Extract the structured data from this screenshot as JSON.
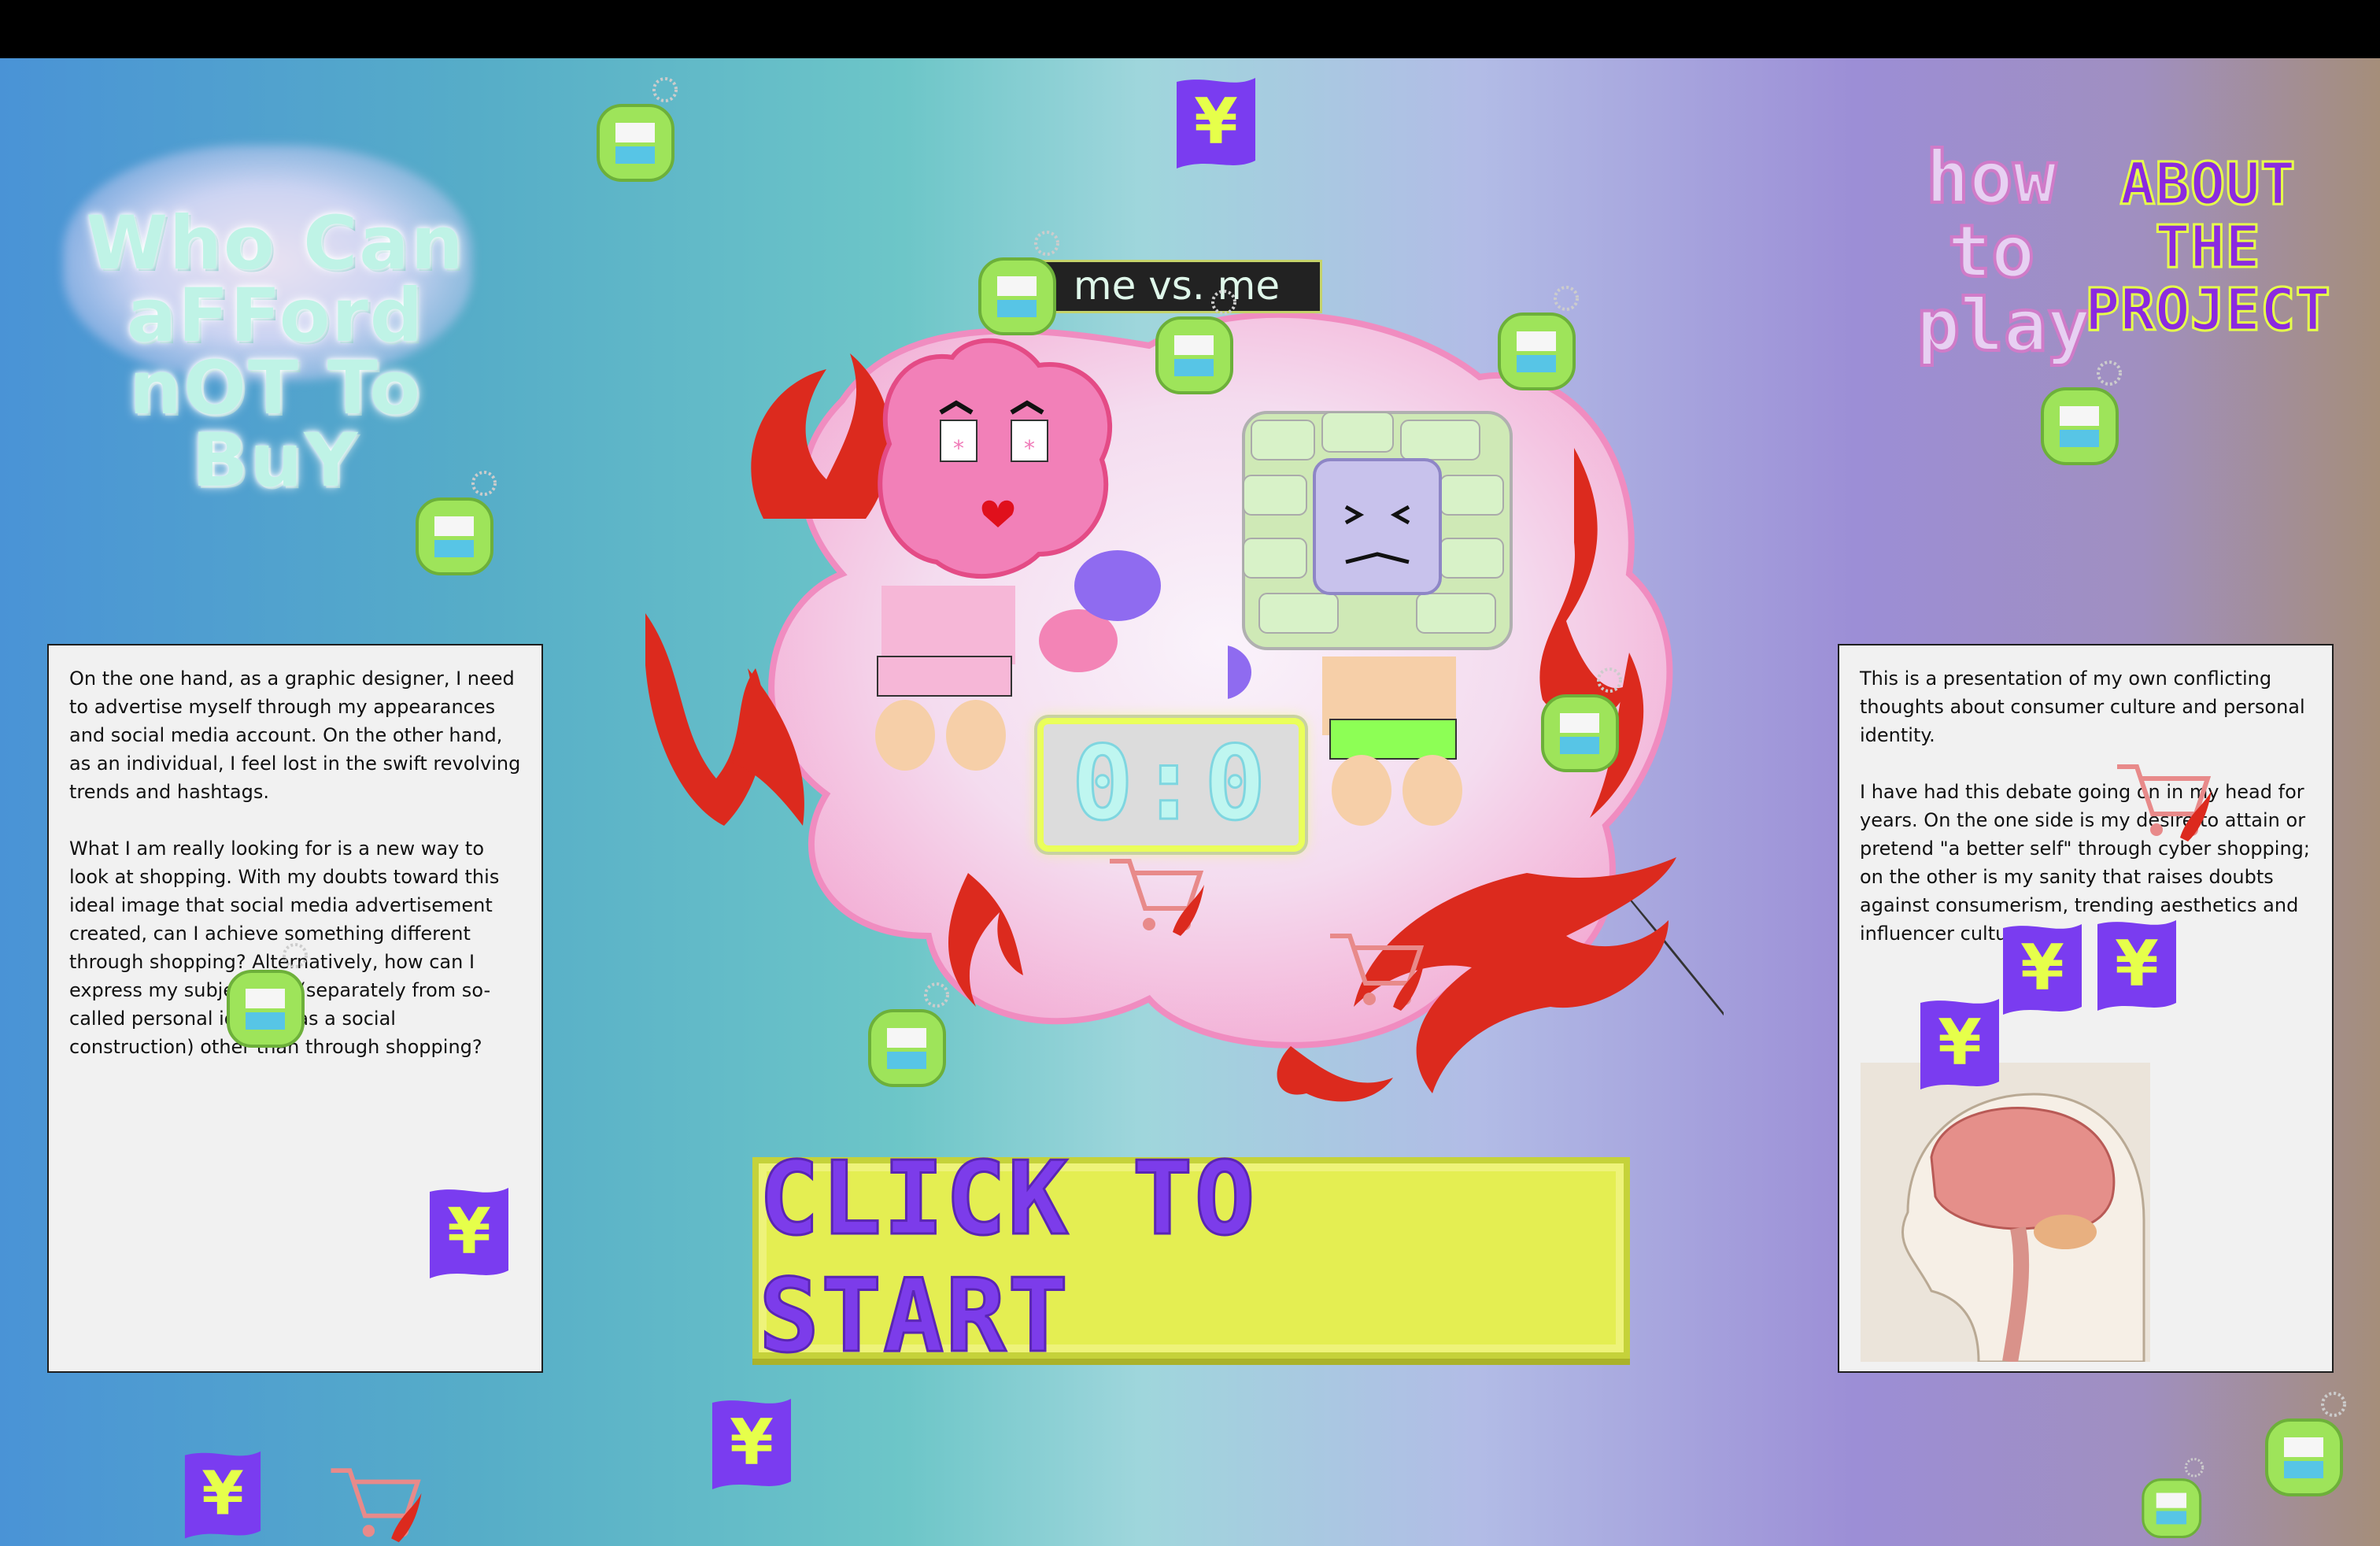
{
  "title": "Who Can aFFord nOT To BuY",
  "nav": {
    "how_to_play": "how to play",
    "about_project": "ABOUT THE PROJECT"
  },
  "game": {
    "label": "me vs. me",
    "score": "0:0",
    "start_label": "CLICK TO START"
  },
  "left_panel": {
    "paragraphs": [
      "On the one hand, as a graphic designer, I need to advertise myself through my appearances and social media account. On the other hand, as an individual, I feel lost in the swift revolving trends and hashtags.",
      "What I am really looking for is a new way to look at shopping. With my doubts toward this ideal image that social media advertisement created, can I achieve something different through shopping? Alternatively, how can I express my subjectivity (separately from so-called personal identity as a social construction) other than through shopping?"
    ]
  },
  "right_panel": {
    "paragraphs": [
      "This is a presentation of my own conflicting thoughts about consumer culture and personal identity.",
      "I have had this debate going on in my head for years. On the one side is my desire to attain or pretend \"a better self\" through cyber shopping; on the other is my sanity that raises doubts against consumerism, trending aesthetics and influencer culture."
    ]
  },
  "colors": {
    "accent_yellow": "#e4ee52",
    "accent_purple": "#7c3cea",
    "flame_red": "#d8281e",
    "cloud_pink": "#f7b8d8"
  },
  "icons": [
    "yen-sticker-icon",
    "tag-keychain-icon",
    "shopping-cart-icon",
    "boxing-glove-icon"
  ]
}
